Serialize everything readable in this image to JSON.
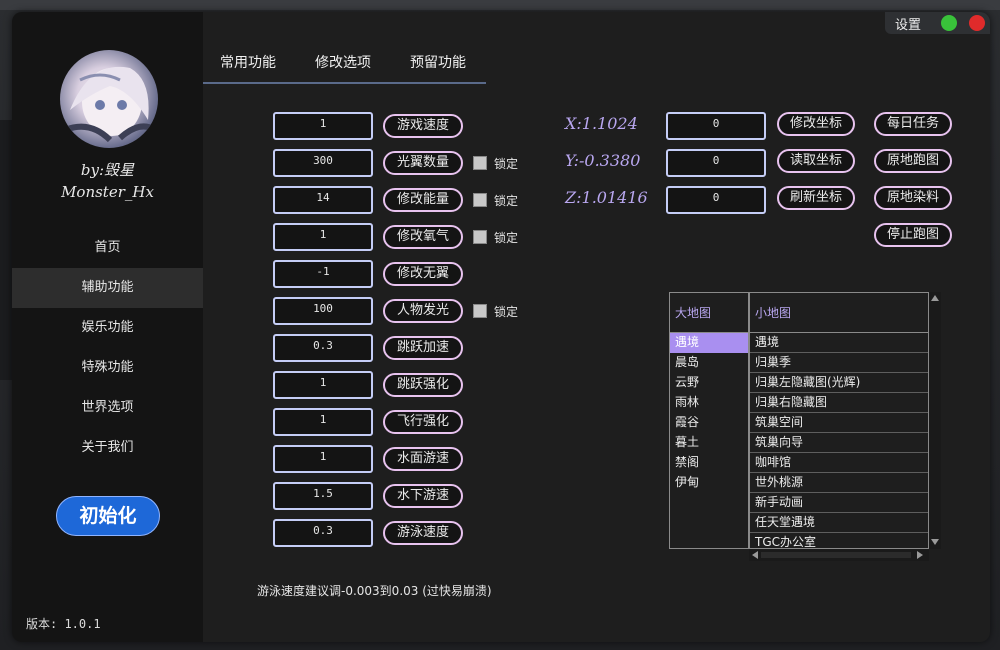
{
  "sidebar": {
    "author_line1": "by:毁星",
    "author_line2": "Monster_Hx",
    "nav": [
      "首页",
      "辅助功能",
      "娱乐功能",
      "特殊功能",
      "世界选项",
      "关于我们"
    ],
    "active_index": 1,
    "init_button": "初始化",
    "version": "版本: 1.0.1"
  },
  "tabs": [
    "常用功能",
    "修改选项",
    "预留功能"
  ],
  "titlebar": {
    "settings": "设置",
    "colors": {
      "green": "#39c23a",
      "red": "#e02b2b"
    }
  },
  "rows": [
    {
      "value": "1",
      "label": "游戏速度"
    },
    {
      "value": "300",
      "label": "光翼数量",
      "lock": "锁定"
    },
    {
      "value": "14",
      "label": "修改能量",
      "lock": "锁定"
    },
    {
      "value": "1",
      "label": "修改氧气",
      "lock": "锁定"
    },
    {
      "value": "-1",
      "label": "修改无翼"
    },
    {
      "value": "100",
      "label": "人物发光",
      "lock": "锁定"
    },
    {
      "value": "0.3",
      "label": "跳跃加速"
    },
    {
      "value": "1",
      "label": "跳跃强化"
    },
    {
      "value": "1",
      "label": "飞行强化"
    },
    {
      "value": "1",
      "label": "水面游速"
    },
    {
      "value": "1.5",
      "label": "水下游速"
    },
    {
      "value": "0.3",
      "label": "游泳速度"
    }
  ],
  "coords": [
    {
      "label": "X:1.1024",
      "value": "0",
      "button": "修改坐标"
    },
    {
      "label": "Y:-0.3380",
      "value": "0",
      "button": "读取坐标"
    },
    {
      "label": "Z:1.01416",
      "value": "0",
      "button": "刷新坐标"
    }
  ],
  "actions": [
    "每日任务",
    "原地跑图",
    "原地染料",
    "停止跑图"
  ],
  "hint": "游泳速度建议调-0.003到0.03 (过快易崩溃)",
  "map_table": {
    "big_header": "大地图",
    "small_header": "小地图",
    "big": [
      "遇境",
      "晨岛",
      "云野",
      "雨林",
      "霞谷",
      "暮土",
      "禁阁",
      "伊甸"
    ],
    "small": [
      "遇境",
      "归巢季",
      "归巢左隐藏图(光辉)",
      "归巢右隐藏图",
      "筑巢空间",
      "筑巢向导",
      "咖啡馆",
      "世外桃源",
      "新手动画",
      "任天堂遇境",
      "TGC办公室"
    ],
    "selected_big": 0
  }
}
